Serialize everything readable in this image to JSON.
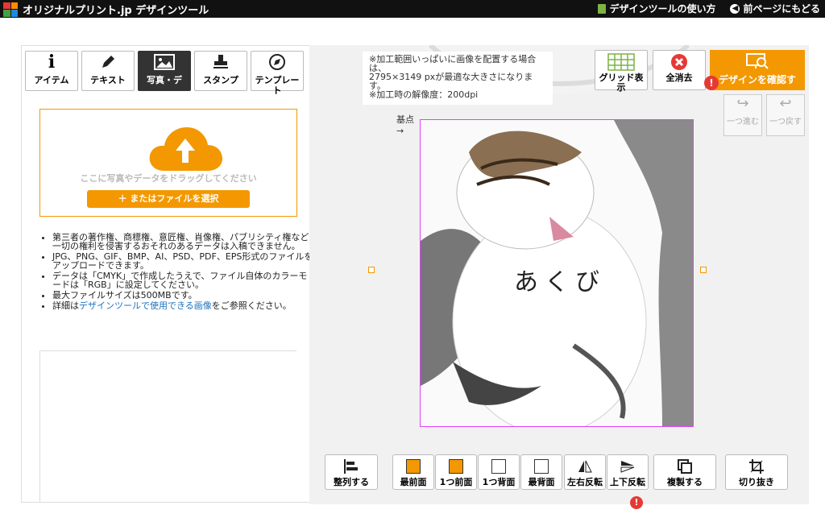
{
  "header": {
    "logo_text": "オリジナルプリント.jp デザインツール",
    "links": [
      "デザインツールの使い方",
      "前ページにもどる"
    ]
  },
  "tabs": [
    {
      "label": "アイテム",
      "icon": "info-icon"
    },
    {
      "label": "テキスト",
      "icon": "pen-icon"
    },
    {
      "label": "写真・デ",
      "icon": "image-icon"
    },
    {
      "label": "スタンプ",
      "icon": "stamp-icon"
    },
    {
      "label": "テンプレート",
      "icon": "compass-icon"
    }
  ],
  "upload": {
    "drag_text": "ここに写真やデータをドラッグしてください",
    "file_button": "＋ またはファイルを選択"
  },
  "notes": {
    "n1": "第三者の著作権、商標権、意匠権、肖像権、パブリシティ権など一切の権利を侵害するおそれのあるデータは入稿できません。",
    "n2": "JPG、PNG、GIF、BMP、AI、PSD、PDF、EPS形式のファイルをアップロードできます。",
    "n3": "データは「CMYK」で作成したうえで、ファイル自体のカラーモードは「RGB」に設定してください。",
    "n4": "最大ファイルサイズは500MBです。",
    "n5_prefix": "詳細は",
    "n5_link": "デザインツールで使用できる画像",
    "n5_suffix": "をご参照ください。"
  },
  "canvas": {
    "info_line1": "※加工範囲いっぱいに画像を配置する場合は、",
    "info_line2": "2795×3149 pxが最適な大きさになります。",
    "info_line3": "※加工時の解像度：200dpi",
    "base_point": "基点",
    "design_text": "あくび"
  },
  "topbuttons": {
    "grid": "グリッド表示",
    "clear": "全消去",
    "confirm": "デザインを確認す",
    "redo": "一つ進む",
    "undo": "一つ戻す"
  },
  "bottombuttons": [
    "整列する",
    "最前面",
    "1つ前面",
    "1つ背面",
    "最背面",
    "左右反転",
    "上下反転",
    "複製する",
    "切り抜き"
  ],
  "colors": {
    "accent": "#f39800",
    "alert": "#e53935",
    "selection": "#e040fb"
  }
}
